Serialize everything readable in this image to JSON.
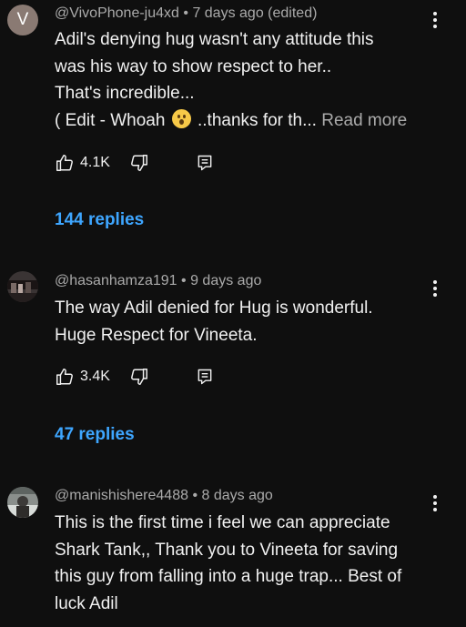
{
  "comments": [
    {
      "avatar_letter": "V",
      "author": "@VivoPhone-ju4xd",
      "time": "7 days ago (edited)",
      "lines": [
        "Adil's denying hug wasn't any attitude this",
        "was his way to show respect to her..",
        "That's incredible..."
      ],
      "last_line_start": "( Edit - Whoah",
      "emoji": "astonished-face",
      "last_line_end": "..thanks for th...",
      "read_more": "Read more",
      "likes": "4.1K",
      "replies": "144 replies"
    },
    {
      "author": "@hasanhamza191",
      "time": "9 days ago",
      "lines": [
        "The way Adil denied for Hug is wonderful.",
        "Huge Respect for Vineeta."
      ],
      "likes": "3.4K",
      "replies": "47 replies"
    },
    {
      "author": "@manishishere4488",
      "time": "8 days ago",
      "lines": [
        "This is the first time i feel we can appreciate",
        "Shark Tank,, Thank you to Vineeta for saving",
        "this guy from falling into a huge trap... Best of",
        "luck Adil"
      ]
    }
  ],
  "separator": "•",
  "colors": {
    "background": "#0f0f0f",
    "text": "#f1f1f1",
    "meta": "#aaaaaa",
    "link": "#3ea6ff"
  },
  "icons": [
    "like-icon",
    "dislike-icon",
    "reply-icon",
    "more-vert-icon"
  ]
}
